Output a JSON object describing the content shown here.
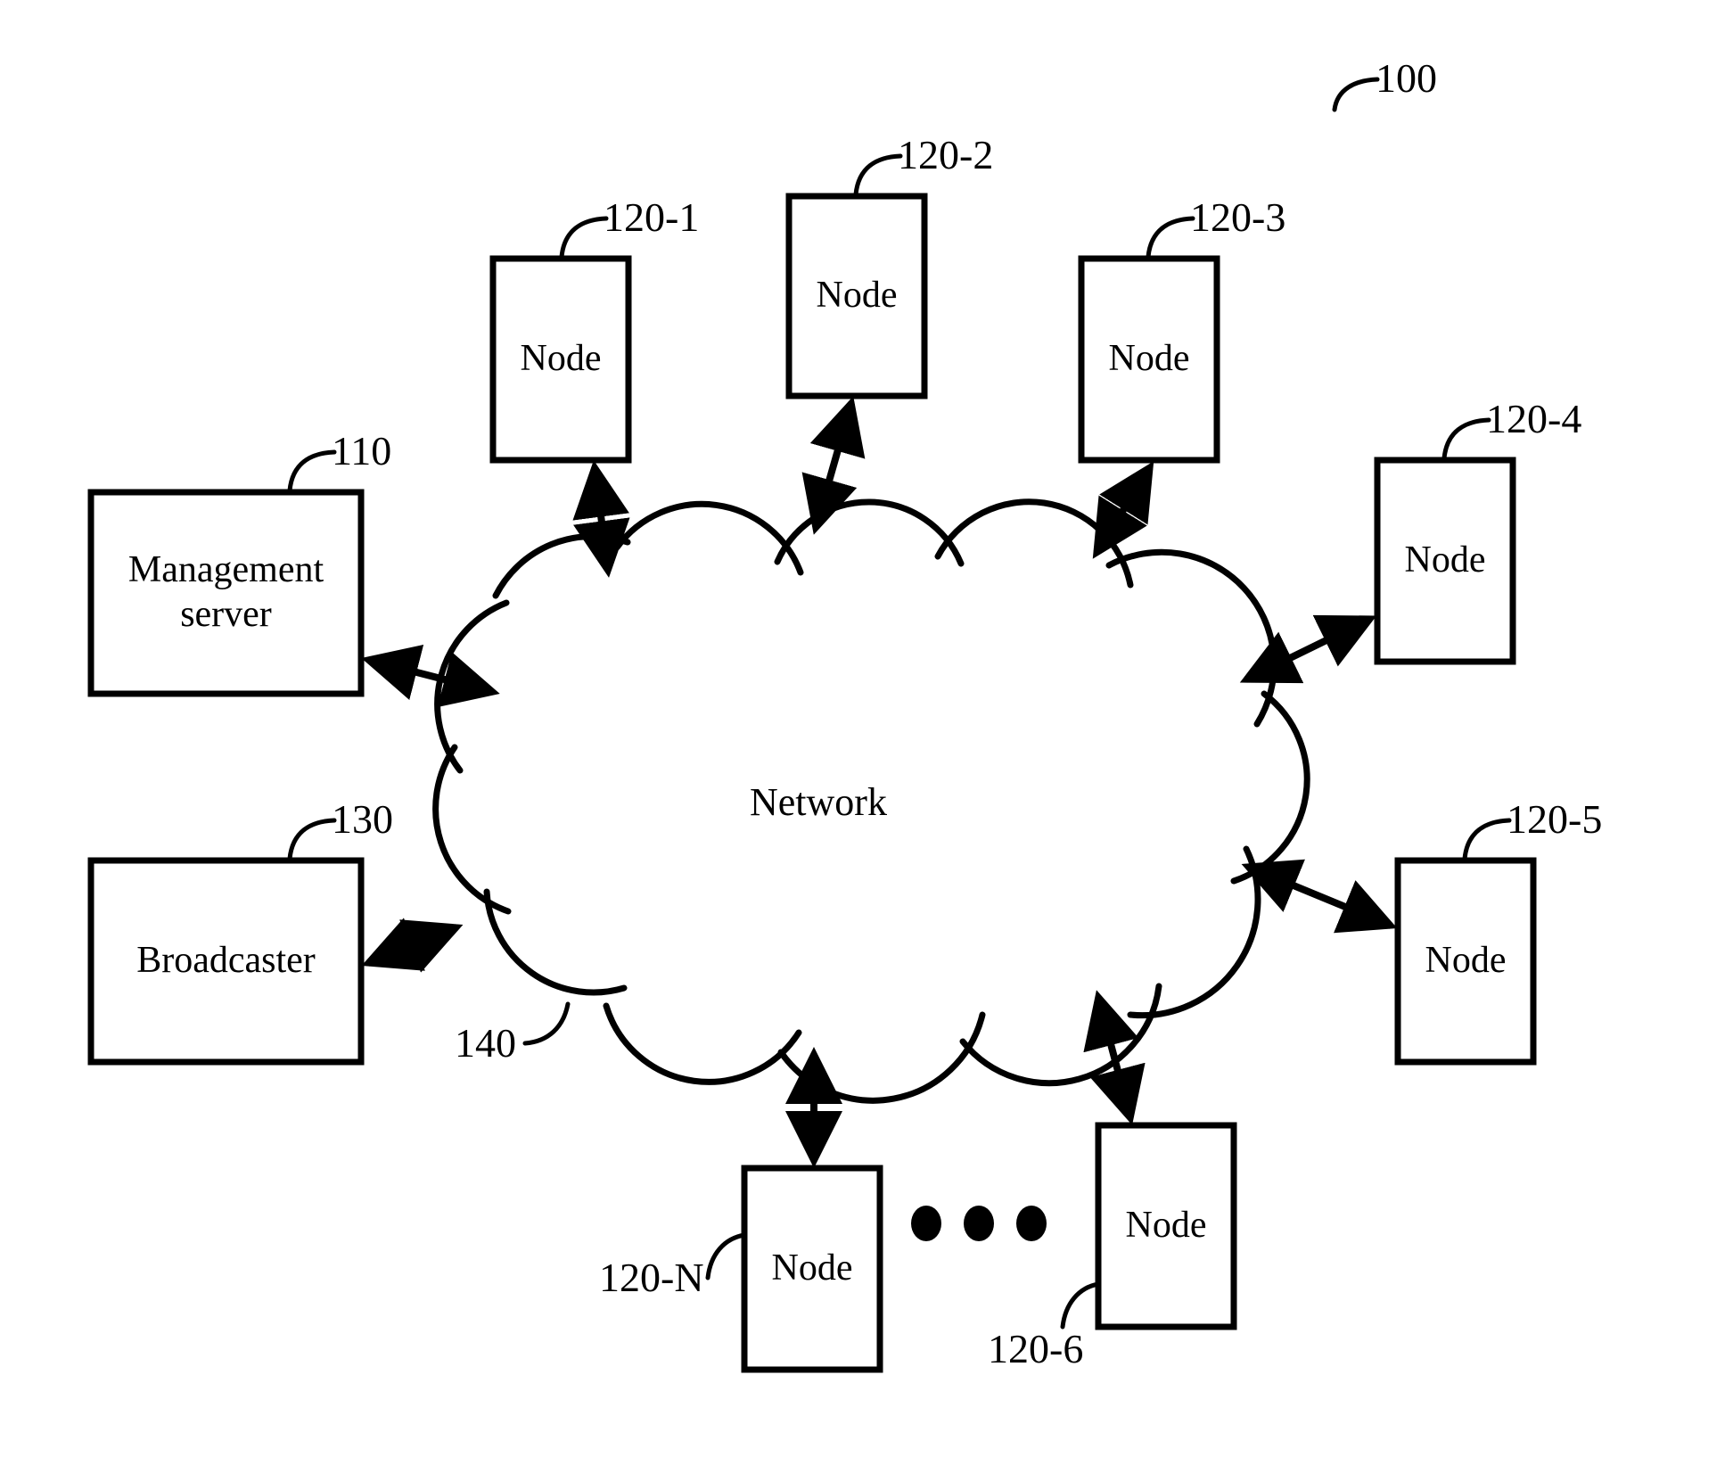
{
  "figure": {
    "system_ref": "100",
    "network_label": "Network",
    "network_ref": "140"
  },
  "blocks": [
    {
      "key": "management_server",
      "label": "Management\nserver",
      "ref": "110"
    },
    {
      "key": "broadcaster",
      "label": "Broadcaster",
      "ref": "130"
    },
    {
      "key": "node_1",
      "label": "Node",
      "ref": "120-1"
    },
    {
      "key": "node_2",
      "label": "Node",
      "ref": "120-2"
    },
    {
      "key": "node_3",
      "label": "Node",
      "ref": "120-3"
    },
    {
      "key": "node_4",
      "label": "Node",
      "ref": "120-4"
    },
    {
      "key": "node_5",
      "label": "Node",
      "ref": "120-5"
    },
    {
      "key": "node_6",
      "label": "Node",
      "ref": "120-6"
    },
    {
      "key": "node_n",
      "label": "Node",
      "ref": "120-N"
    }
  ],
  "ellipsis": {
    "dot_count": 3
  },
  "colors": {
    "stroke": "#000000",
    "background": "#ffffff",
    "text": "#000000"
  }
}
